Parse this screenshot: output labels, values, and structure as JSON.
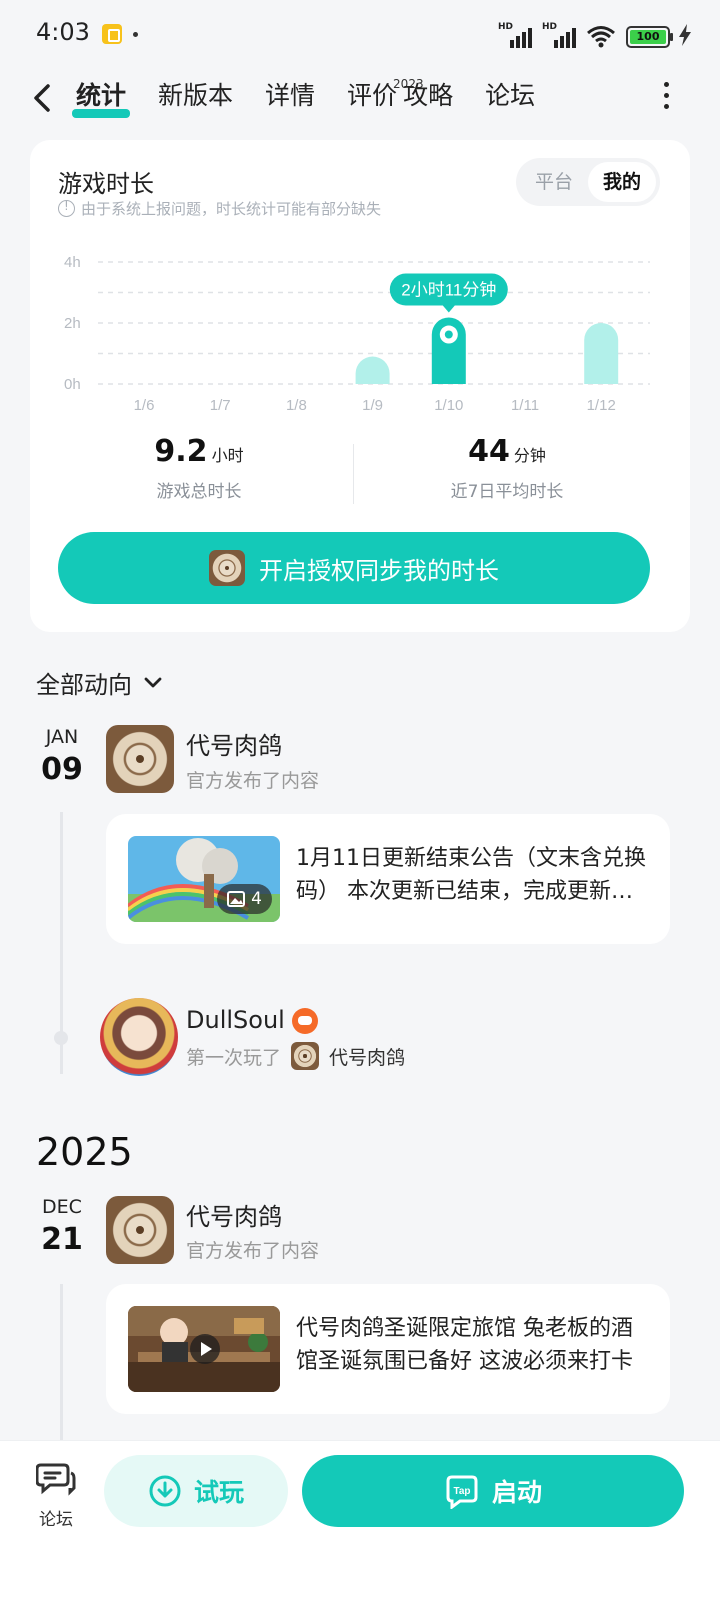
{
  "status": {
    "time": "4:03",
    "battery": "100",
    "hd_label": "HD"
  },
  "nav": {
    "tabs": [
      {
        "label": "统计",
        "active": true
      },
      {
        "label": "新版本"
      },
      {
        "label": "详情"
      },
      {
        "label": "评价",
        "sup": "2023"
      },
      {
        "label": "攻略"
      },
      {
        "label": "论坛"
      }
    ]
  },
  "stats": {
    "title": "游戏时长",
    "note": "由于系统上报问题，时长统计可能有部分缺失",
    "toggle": {
      "option_platform": "平台",
      "option_mine": "我的",
      "selected": "我的"
    },
    "total": {
      "value": "9.2",
      "unit": "小时",
      "label": "游戏总时长"
    },
    "average": {
      "value": "44",
      "unit": "分钟",
      "label": "近7日平均时长"
    },
    "sync_button": "开启授权同步我的时长"
  },
  "chart_data": {
    "type": "bar",
    "categories": [
      "1/6",
      "1/7",
      "1/8",
      "1/9",
      "1/10",
      "1/11",
      "1/12"
    ],
    "values": [
      0,
      0,
      0,
      0.9,
      2.18,
      0,
      2.0
    ],
    "y_ticks": [
      "0h",
      "2h",
      "4h"
    ],
    "ylim": [
      0,
      4
    ],
    "selected_index": 4,
    "tooltip": "2小时11分钟",
    "colors": {
      "bar": "#b2f0ea",
      "selected": "#14c9b8",
      "grid": "#dfe2e6"
    }
  },
  "feed": {
    "filter_label": "全部动向",
    "entries": [
      {
        "month": "JAN",
        "day": "09",
        "poster": "代号肉鸽",
        "action": "官方发布了内容",
        "post_text": "1月11日更新结束公告（文末含兑换码） 本次更新已结束，完成更新即可进入游戏",
        "image_count": "4"
      },
      {
        "user": "DullSoul",
        "action": "第一次玩了",
        "game": "代号肉鸽"
      }
    ],
    "year": "2025",
    "entries_2025": [
      {
        "month": "DEC",
        "day": "21",
        "poster": "代号肉鸽",
        "action": "官方发布了内容",
        "post_text": "代号肉鸽圣诞限定旅馆 兔老板的酒馆圣诞氛围已备好 这波必须来打卡"
      }
    ]
  },
  "bottom": {
    "forum_label": "论坛",
    "trial_label": "试玩",
    "launch_label": "启动"
  }
}
